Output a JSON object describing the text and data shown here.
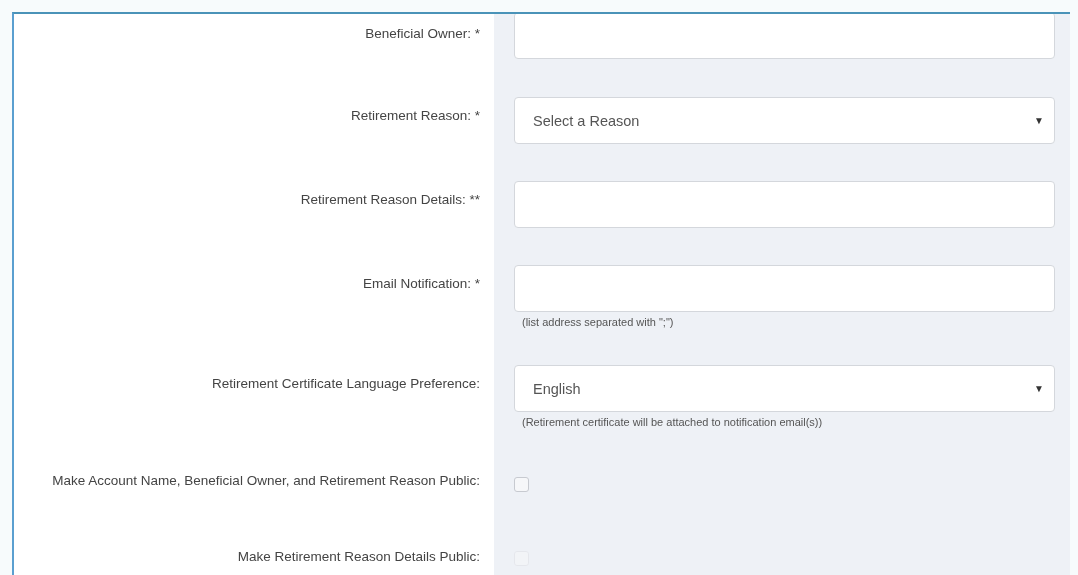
{
  "fields": [
    {
      "kind": "text",
      "label": "Beneficial Owner: *"
    },
    {
      "kind": "select",
      "label": "Retirement Reason: *",
      "value": "Select a Reason",
      "arrow": "▼"
    },
    {
      "kind": "text",
      "label": "Retirement Reason Details: **"
    },
    {
      "kind": "text",
      "label": "Email Notification: *",
      "hint": "(list address separated with \";\")"
    },
    {
      "kind": "select",
      "label": "Retirement Certificate Language Preference:",
      "value": "English",
      "arrow": "▼",
      "hint": "(Retirement certificate will be attached to notification email(s))"
    },
    {
      "kind": "checkbox",
      "label": "Make Account Name, Beneficial Owner, and Retirement Reason Public:",
      "checked": false,
      "disabled": false
    },
    {
      "kind": "checkbox",
      "label": "Make Retirement Reason Details Public:",
      "checked": false,
      "disabled": true
    }
  ]
}
